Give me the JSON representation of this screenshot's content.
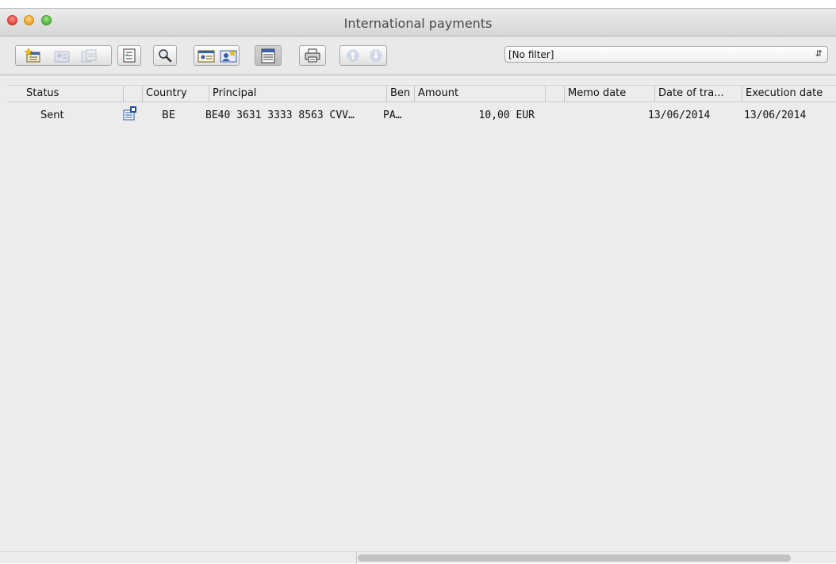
{
  "window": {
    "title": "International payments"
  },
  "toolbar": {
    "icons": [
      "new-payment-icon",
      "open-payment-icon",
      "duplicate-icon",
      "checklist-icon",
      "search-icon",
      "details-icon",
      "beneficiary-icon",
      "calendar-icon",
      "print-icon",
      "arrow-up-icon",
      "arrow-down-icon"
    ]
  },
  "filter": {
    "label": "[No filter]"
  },
  "table": {
    "columns": [
      "Status",
      "",
      "Country",
      "Principal",
      "Ben",
      "Amount",
      "",
      "Memo date",
      "Date of tra...",
      "Execution date"
    ],
    "rows": [
      {
        "status": "Sent",
        "country": "BE",
        "principal": "BE40 3631 3333 8563 CVV…",
        "ben": "PA…",
        "amount": "10,00 EUR",
        "memo_date": "",
        "date_of_transfer": "13/06/2014",
        "execution_date": "13/06/2014"
      }
    ]
  },
  "colors": {
    "accent": "#1f4fa8",
    "background": "#ececec"
  }
}
